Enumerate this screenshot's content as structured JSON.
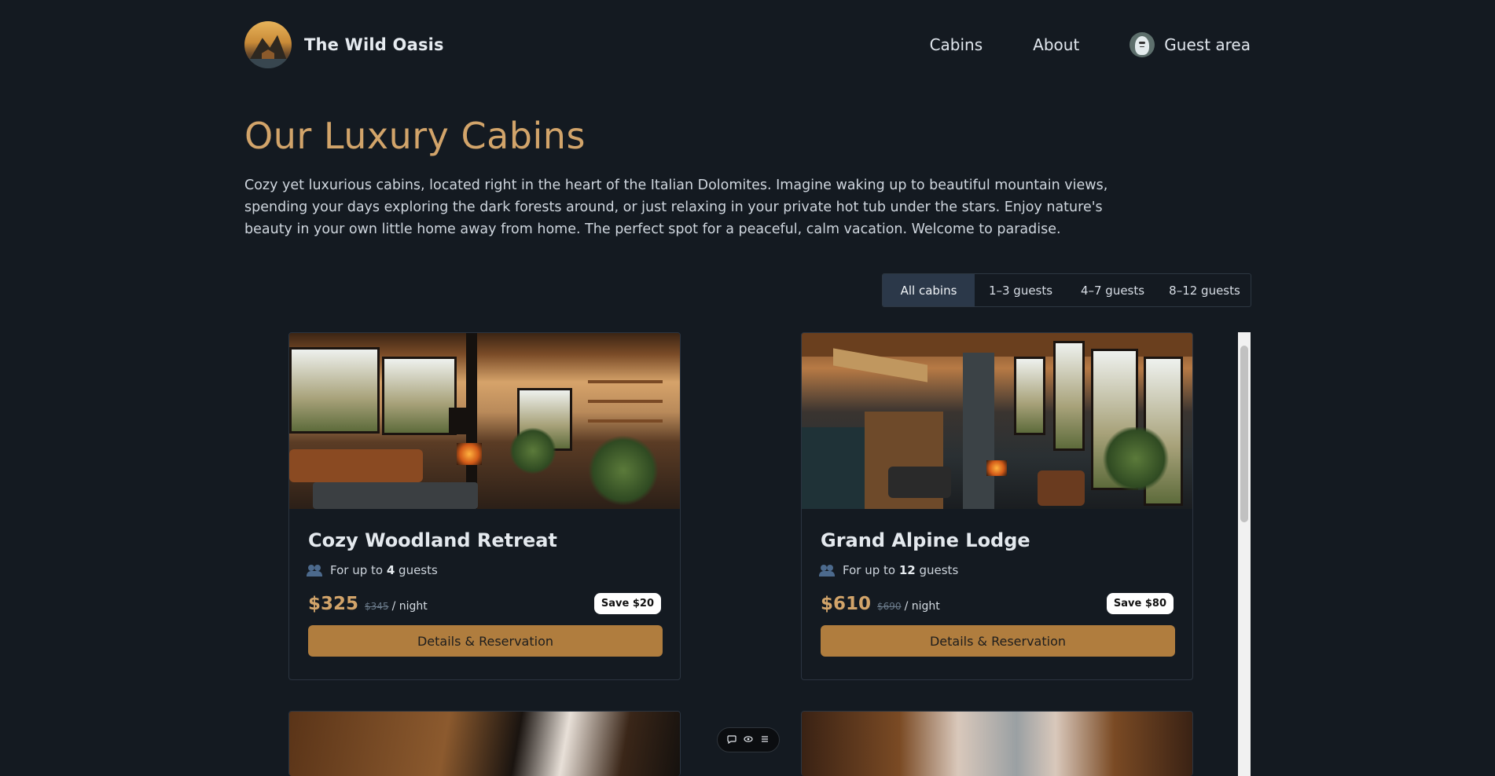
{
  "brand": {
    "name": "The Wild Oasis"
  },
  "nav": {
    "items": [
      {
        "label": "Cabins"
      },
      {
        "label": "About"
      }
    ],
    "guest_area": "Guest area"
  },
  "page": {
    "title": "Our Luxury Cabins",
    "intro": "Cozy yet luxurious cabins, located right in the heart of the Italian Dolomites. Imagine waking up to beautiful mountain views, spending your days exploring the dark forests around, or just relaxing in your private hot tub under the stars. Enjoy nature's beauty in your own little home away from home. The perfect spot for a peaceful, calm vacation. Welcome to paradise."
  },
  "filter": {
    "options": [
      {
        "label": "All cabins",
        "active": true
      },
      {
        "label": "1–3 guests",
        "active": false
      },
      {
        "label": "4–7 guests",
        "active": false
      },
      {
        "label": "8–12 guests",
        "active": false
      }
    ]
  },
  "cabins": [
    {
      "name": "Cozy Woodland Retreat",
      "capacity_prefix": "For up to ",
      "capacity": "4",
      "capacity_suffix": " guests",
      "price": "$325",
      "old_price": "$345",
      "per": "/ night",
      "discount": "Save $20",
      "button": "Details & Reservation"
    },
    {
      "name": "Grand Alpine Lodge",
      "capacity_prefix": "For up to ",
      "capacity": "12",
      "capacity_suffix": " guests",
      "price": "$610",
      "old_price": "$690",
      "per": "/ night",
      "discount": "Save $80",
      "button": "Details & Reservation"
    }
  ],
  "toolbar": {
    "icons": [
      "comment-icon",
      "eye-icon",
      "menu-icon"
    ]
  },
  "colors": {
    "background": "#141a21",
    "accent": "#d2a46a",
    "button": "#b07d3e",
    "filter_active": "#2b3849"
  }
}
